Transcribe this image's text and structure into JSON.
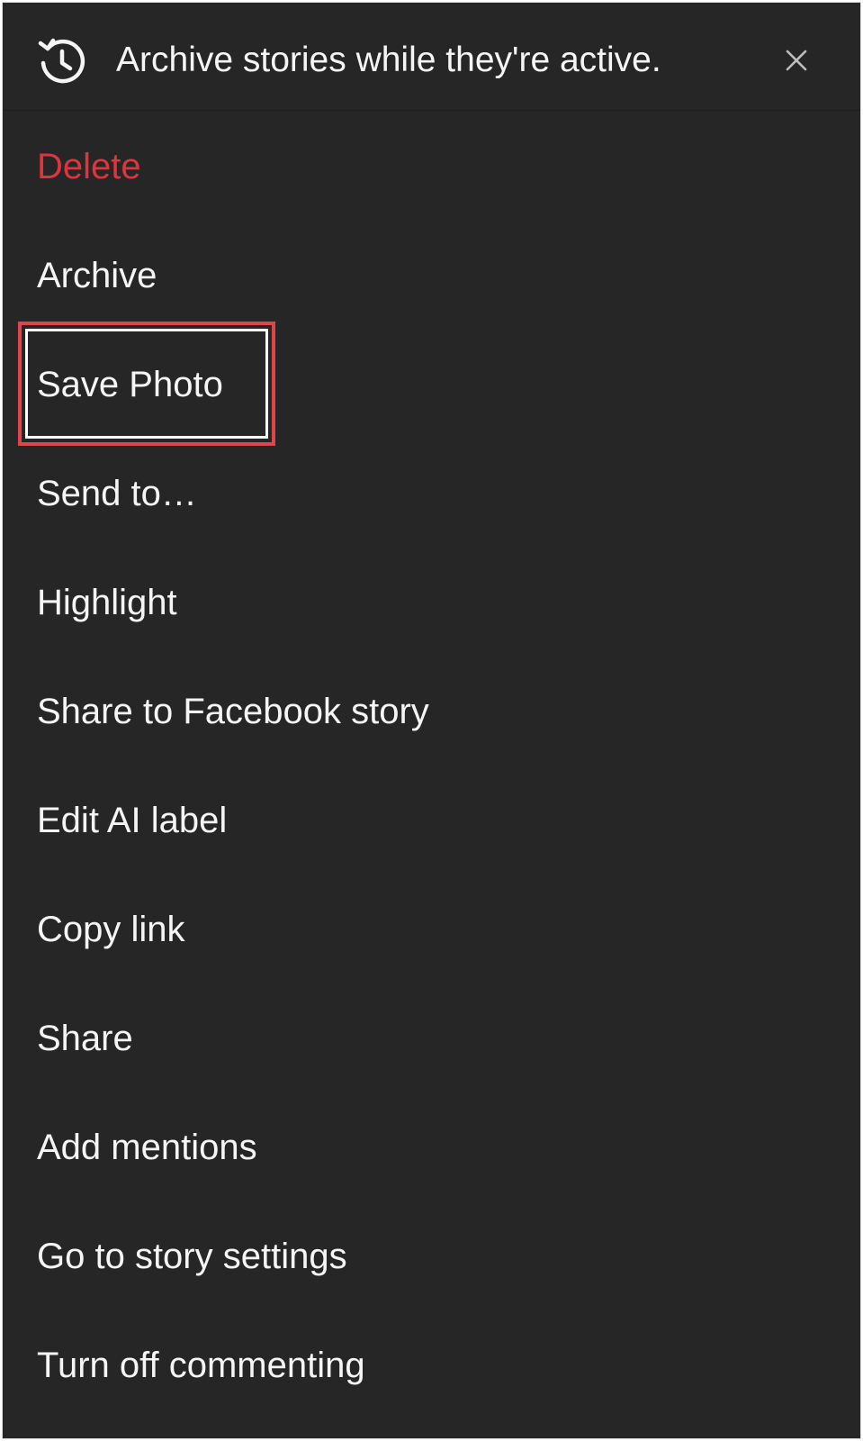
{
  "banner": {
    "icon": "history-clock-icon",
    "text": "Archive stories while they're active.",
    "close_icon": "close-icon"
  },
  "menu": {
    "items": [
      {
        "label": "Delete",
        "style": "destructive",
        "color": "#e0333e"
      },
      {
        "label": "Archive"
      },
      {
        "label": "Save Photo",
        "highlighted": true
      },
      {
        "label": "Send to…"
      },
      {
        "label": "Highlight"
      },
      {
        "label": "Share to Facebook story"
      },
      {
        "label": "Edit AI label"
      },
      {
        "label": "Copy link"
      },
      {
        "label": "Share"
      },
      {
        "label": "Add mentions"
      },
      {
        "label": "Go to story settings"
      },
      {
        "label": "Turn off commenting"
      }
    ]
  },
  "colors": {
    "background": "#262626",
    "text": "#f5f5f5",
    "destructive": "#e0333e",
    "highlight_outline": "#e0454c"
  }
}
